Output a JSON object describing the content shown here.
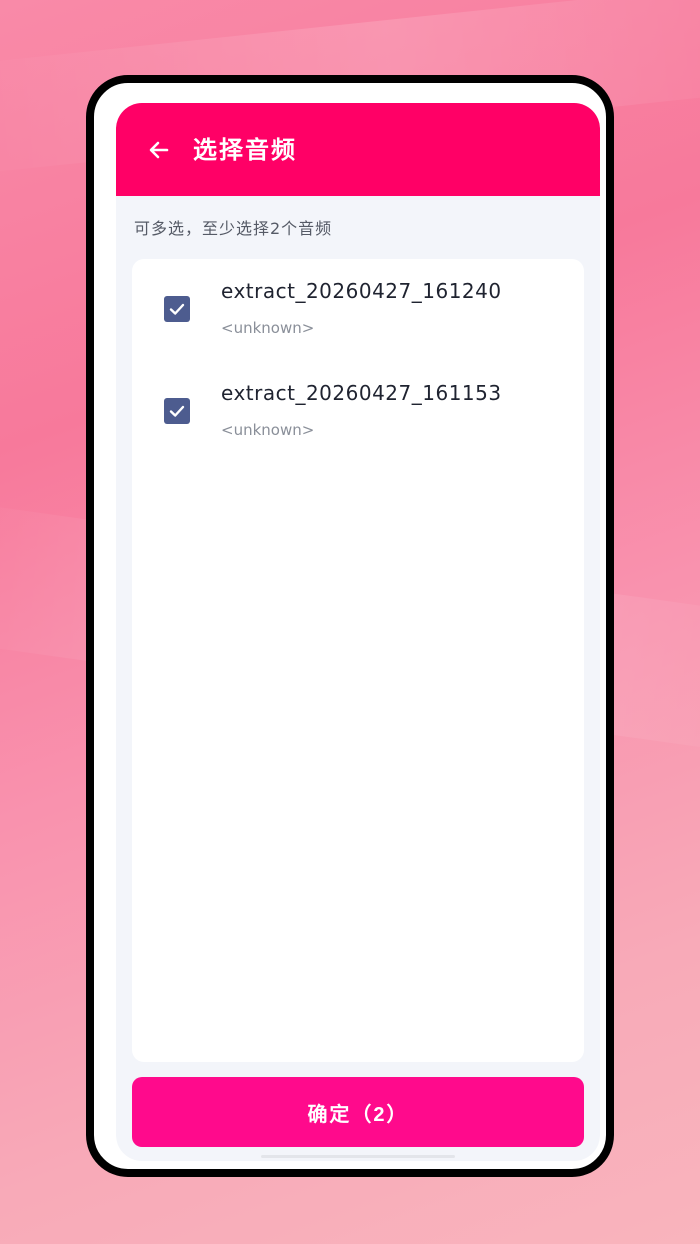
{
  "header": {
    "back_icon": "arrow-left-icon",
    "title": "选择音频"
  },
  "hint": "可多选，至少选择2个音频",
  "audio_list": [
    {
      "name": "extract_20260427_161240",
      "subtitle": "<unknown>",
      "checked": true
    },
    {
      "name": "extract_20260427_161153",
      "subtitle": "<unknown>",
      "checked": true
    }
  ],
  "confirm_button": {
    "label": "确定（2）"
  },
  "colors": {
    "appbar": "#ff0066",
    "confirm": "#ff0a8c",
    "checkbox": "#4d5c8f",
    "screen_bg": "#f3f5fa"
  }
}
